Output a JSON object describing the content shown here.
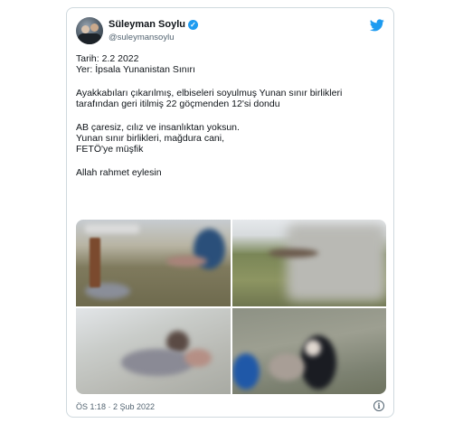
{
  "tweet": {
    "author_name": "Süleyman Soylu",
    "handle": "@suleymansoylu",
    "lines": {
      "date": "Tarih: 2.2 2022",
      "place": "Yer: İpsala Yunanistan Sınırı",
      "body": "Ayakkabıları çıkarılmış, elbiseleri soyulmuş Yunan sınır birlikleri tarafından geri itilmiş 22 göçmenden 12'si dondu",
      "line1": "AB çaresiz, cılız ve insanlıktan yoksun.",
      "line2": "Yunan sınır birlikleri, mağdura cani,",
      "line3": "FETÖ'ye müşfik",
      "closing": "Allah rahmet eylesin"
    },
    "timestamp": "ÖS 1:18 · 2 Şub 2022"
  },
  "icons": {
    "verified": "verified-badge-icon",
    "brand": "twitter-bird-icon",
    "info": "info-icon"
  },
  "colors": {
    "brand_blue": "#1d9bf0",
    "text_primary": "#0f1419",
    "text_secondary": "#536471",
    "border": "#cfd9de"
  }
}
